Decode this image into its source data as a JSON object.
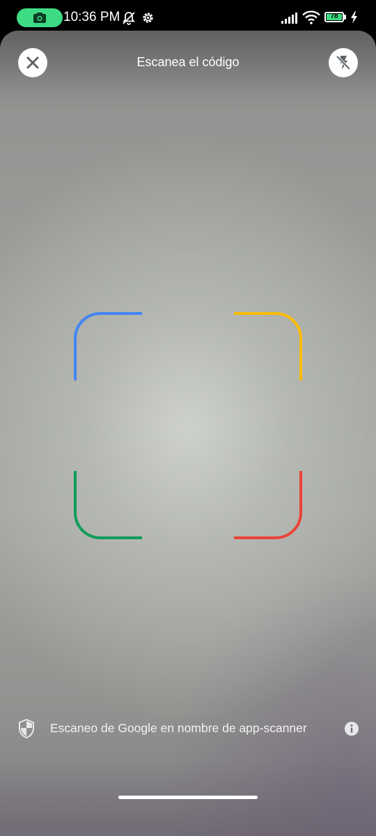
{
  "status_bar": {
    "time": "10:36 PM",
    "battery_level": "78",
    "icons": [
      "camera-icon",
      "bell-off-icon",
      "settings-gear-icon",
      "signal-icon",
      "wifi-icon",
      "battery-icon",
      "charging-bolt-icon"
    ]
  },
  "header": {
    "title": "Escanea el código",
    "close_icon": "close-icon",
    "flash_icon": "flash-off-icon"
  },
  "scan_frame": {
    "corner_colors": {
      "top_left": "#4285F4",
      "top_right": "#FBBC04",
      "bottom_left": "#0F9D58",
      "bottom_right": "#EA4335"
    }
  },
  "footer": {
    "text": "Escaneo de Google en nombre de app-scanner",
    "shield_icon": "shield-icon",
    "info_icon": "info-icon"
  }
}
